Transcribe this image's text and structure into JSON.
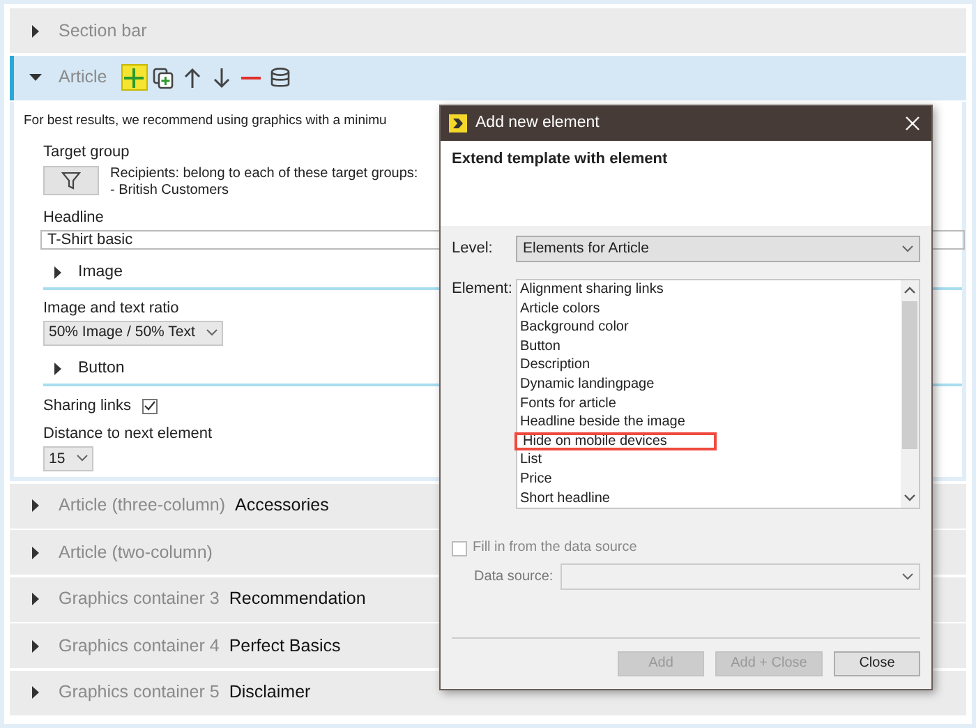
{
  "sections": [
    {
      "type": "Section bar",
      "expanded": false
    },
    {
      "type": "Article",
      "expanded": true,
      "toolbar": [
        {
          "kind": "add",
          "selected": true
        },
        {
          "kind": "duplicate",
          "selected": false
        },
        {
          "kind": "up",
          "selected": false
        },
        {
          "kind": "down",
          "selected": false
        },
        {
          "kind": "remove",
          "selected": false
        },
        {
          "kind": "database",
          "selected": false
        }
      ],
      "fields": [
        {
          "kind": "notice",
          "text": "For best results, we recommend using graphics with a minimu"
        },
        {
          "kind": "target_group",
          "label": "Target group",
          "lines": [
            "Recipients: belong to each of these target groups:",
            "- British Customers"
          ]
        },
        {
          "kind": "text",
          "label": "Headline",
          "value": "T-Shirt basic"
        },
        {
          "kind": "group",
          "label": "Image",
          "expanded": false
        },
        {
          "kind": "select",
          "label": "Image and text ratio",
          "value": "50% Image / 50% Text"
        },
        {
          "kind": "group",
          "label": "Button",
          "expanded": false
        },
        {
          "kind": "checkbox",
          "label": "Sharing links",
          "checked": true
        },
        {
          "kind": "select",
          "label": "Distance to next element",
          "value": "15"
        }
      ]
    },
    {
      "type": "Article (three-column)",
      "name": "Accessories",
      "expanded": false
    },
    {
      "type": "Article (two-column)",
      "expanded": false
    },
    {
      "type": "Graphics container 3",
      "name": "Recommendation",
      "expanded": false
    },
    {
      "type": "Graphics container 4",
      "name": "Perfect Basics",
      "expanded": false
    },
    {
      "type": "Graphics container 5",
      "name": "Disclaimer",
      "expanded": false
    }
  ],
  "dialog": {
    "title": "Add new element",
    "heading": "Extend template with element",
    "level": {
      "label": "Level:",
      "value": "Elements for Article"
    },
    "element": {
      "label": "Element:",
      "items": [
        {
          "label": "Alignment sharing links",
          "highlighted": false
        },
        {
          "label": "Article colors",
          "highlighted": false
        },
        {
          "label": "Background color",
          "highlighted": false
        },
        {
          "label": "Button",
          "highlighted": false
        },
        {
          "label": "Description",
          "highlighted": false
        },
        {
          "label": "Dynamic landingpage",
          "highlighted": false
        },
        {
          "label": "Fonts for article",
          "highlighted": false
        },
        {
          "label": "Headline beside the image",
          "highlighted": false
        },
        {
          "label": "Hide on mobile devices",
          "highlighted": true
        },
        {
          "label": "List",
          "highlighted": false
        },
        {
          "label": "Price",
          "highlighted": false
        },
        {
          "label": "Short headline",
          "highlighted": false
        }
      ]
    },
    "fill": {
      "label": "Fill in from the data source",
      "checked": false,
      "disabled": true
    },
    "data_source": {
      "label": "Data source:",
      "disabled": true
    },
    "buttons": [
      {
        "label": "Add",
        "disabled": true
      },
      {
        "label": "Add + Close",
        "disabled": true
      },
      {
        "label": "Close",
        "disabled": false
      }
    ]
  }
}
